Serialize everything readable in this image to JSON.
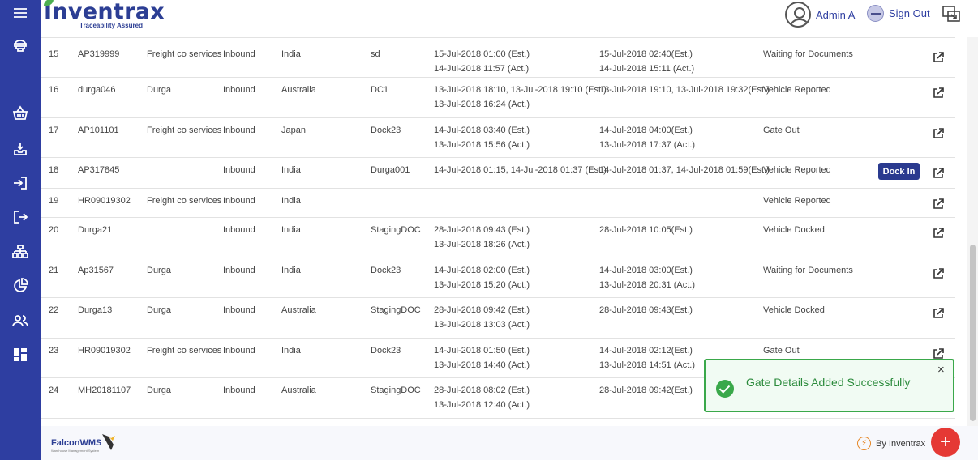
{
  "header": {
    "logo_text": "Inventrax",
    "logo_tagline": "Traceability Assured",
    "user_name": "Admin A",
    "signout_label": "Sign Out"
  },
  "sidebar": {
    "items": [
      "menu-icon",
      "cloud-stack-icon",
      "basket-icon",
      "inbox-icon",
      "login-icon",
      "logout-icon",
      "hierarchy-icon",
      "pie-chart-icon",
      "users-icon",
      "dashboard-icon"
    ]
  },
  "rows": [
    {
      "no": "15",
      "vehicle": "AP319999",
      "customer": "Freight co services",
      "type": "Inbound",
      "country": "India",
      "dock": "sd",
      "arr1": "15-Jul-2018 01:00 (Est.)",
      "arr2": "14-Jul-2018 11:57 (Act.)",
      "dep1": "15-Jul-2018 02:40(Est.)",
      "dep2": "14-Jul-2018 15:11 (Act.)",
      "status": "Waiting for Documents"
    },
    {
      "no": "16",
      "vehicle": "durga046",
      "customer": "Durga",
      "type": "Inbound",
      "country": "Australia",
      "dock": "DC1",
      "arr1": "13-Jul-2018 18:10, 13-Jul-2018 19:10 (Est.)",
      "arr2": "13-Jul-2018 16:24 (Act.)",
      "dep1": "13-Jul-2018 19:10, 13-Jul-2018 19:32(Est.)",
      "dep2": "",
      "status": "Vehicle Reported"
    },
    {
      "no": "17",
      "vehicle": "AP101101",
      "customer": "Freight co services",
      "type": "Inbound",
      "country": "Japan",
      "dock": "Dock23",
      "arr1": "14-Jul-2018 03:40 (Est.)",
      "arr2": "13-Jul-2018 15:56 (Act.)",
      "dep1": "14-Jul-2018 04:00(Est.)",
      "dep2": "13-Jul-2018 17:37 (Act.)",
      "status": "Gate Out"
    },
    {
      "no": "18",
      "vehicle": "AP317845",
      "customer": "",
      "type": "Inbound",
      "country": "India",
      "dock": "Durga001",
      "arr1": "14-Jul-2018 01:15, 14-Jul-2018 01:37 (Est.)",
      "arr2": "",
      "dep1": "14-Jul-2018 01:37, 14-Jul-2018 01:59(Est.)",
      "dep2": "",
      "status": "Vehicle Reported",
      "action": "Dock In"
    },
    {
      "no": "19",
      "vehicle": "HR09019302",
      "customer": "Freight co services",
      "type": "Inbound",
      "country": "India",
      "dock": "",
      "arr1": "",
      "arr2": "",
      "dep1": "",
      "dep2": "",
      "status": "Vehicle Reported"
    },
    {
      "no": "20",
      "vehicle": "Durga21",
      "customer": "",
      "type": "Inbound",
      "country": "India",
      "dock": "StagingDOC",
      "arr1": "28-Jul-2018 09:43 (Est.)",
      "arr2": "13-Jul-2018 18:26 (Act.)",
      "dep1": "28-Jul-2018 10:05(Est.)",
      "dep2": "",
      "status": "Vehicle Docked"
    },
    {
      "no": "21",
      "vehicle": "Ap31567",
      "customer": "Durga",
      "type": "Inbound",
      "country": "India",
      "dock": "Dock23",
      "arr1": "14-Jul-2018 02:00 (Est.)",
      "arr2": "13-Jul-2018 15:20 (Act.)",
      "dep1": "14-Jul-2018 03:00(Est.)",
      "dep2": "13-Jul-2018 20:31 (Act.)",
      "status": "Waiting for Documents"
    },
    {
      "no": "22",
      "vehicle": "Durga13",
      "customer": "Durga",
      "type": "Inbound",
      "country": "Australia",
      "dock": "StagingDOC",
      "arr1": "28-Jul-2018 09:42 (Est.)",
      "arr2": "13-Jul-2018 13:03 (Act.)",
      "dep1": "28-Jul-2018 09:43(Est.)",
      "dep2": "",
      "status": "Vehicle Docked"
    },
    {
      "no": "23",
      "vehicle": "HR09019302",
      "customer": "Freight co services",
      "type": "Inbound",
      "country": "India",
      "dock": "Dock23",
      "arr1": "14-Jul-2018 01:50 (Est.)",
      "arr2": "13-Jul-2018 14:40 (Act.)",
      "dep1": "14-Jul-2018 02:12(Est.)",
      "dep2": "13-Jul-2018 14:51 (Act.)",
      "status": "Gate Out"
    },
    {
      "no": "24",
      "vehicle": "MH20181107",
      "customer": "Durga",
      "type": "Inbound",
      "country": "Australia",
      "dock": "StagingDOC",
      "arr1": "28-Jul-2018 08:02 (Est.)",
      "arr2": "13-Jul-2018 12:40 (Act.)",
      "dep1": "28-Jul-2018 09:42(Est.)",
      "dep2": "",
      "status": ""
    }
  ],
  "toast": {
    "message": "Gate Details Added Successfully",
    "close_symbol": "×"
  },
  "footer": {
    "brand": "FalconWMS",
    "brand_sub": "Warehouse Management System",
    "by_label": "By Inventrax",
    "fab_symbol": "+"
  },
  "colors": {
    "sidebar": "#2e3ea1",
    "brand": "#2c3e94",
    "success": "#3aa84a",
    "fab": "#e53935"
  }
}
